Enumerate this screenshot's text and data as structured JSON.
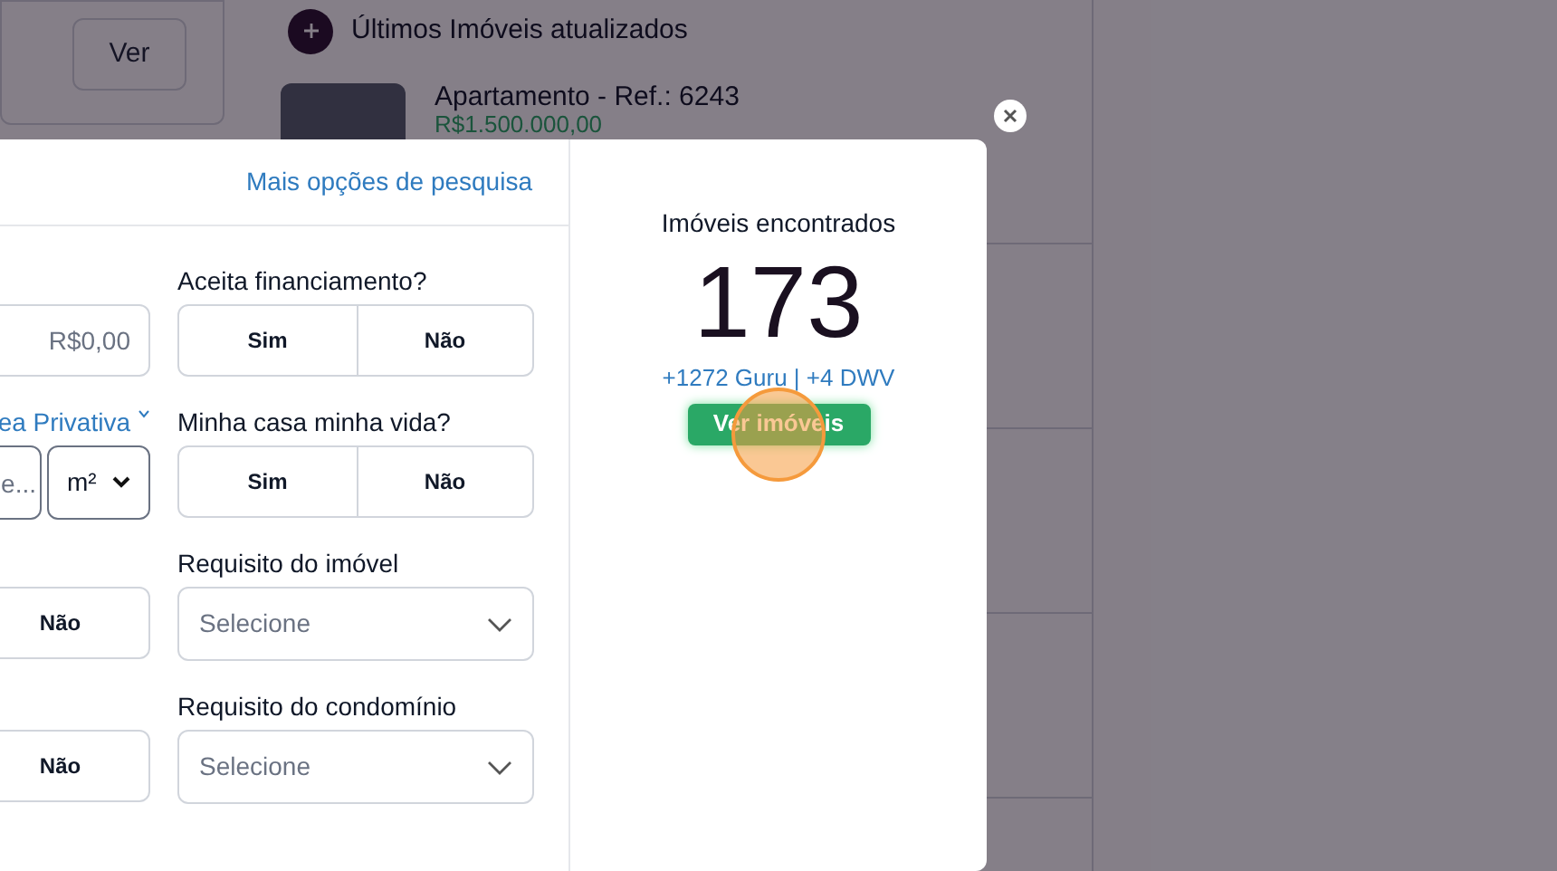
{
  "background": {
    "card_button": "Ver",
    "recent": {
      "title": "Últimos Imóveis atualizados",
      "listing": {
        "title": "Apartamento - Ref.: 6243",
        "price": "R$1.500.000,00"
      }
    }
  },
  "search_modal": {
    "more_options_link": "Mais opções de pesquisa",
    "rows": [
      {
        "left": {
          "kind": "input",
          "placeholder": "R$0,00"
        },
        "right": {
          "kind": "toggle",
          "label": "Aceita financiamento?",
          "options": [
            "Sim",
            "Não"
          ]
        }
      },
      {
        "left": {
          "kind": "area",
          "label": "ea Privativa",
          "placeholder": "e...",
          "unit": "m²"
        },
        "right": {
          "kind": "toggle",
          "label": "Minha casa minha vida?",
          "options": [
            "Sim",
            "Não"
          ]
        }
      },
      {
        "left": {
          "kind": "toggle",
          "options": [
            "Não"
          ]
        },
        "right": {
          "kind": "select",
          "label": "Requisito do imóvel",
          "placeholder": "Selecione"
        }
      },
      {
        "left": {
          "kind": "toggle",
          "options": [
            "Não"
          ]
        },
        "right": {
          "kind": "select",
          "label": "Requisito do condomínio",
          "placeholder": "Selecione"
        }
      }
    ],
    "results": {
      "title": "Imóveis encontrados",
      "count": "173",
      "sources": "+1272 Guru | +4 DWV",
      "button": "Ver imóveis"
    }
  }
}
